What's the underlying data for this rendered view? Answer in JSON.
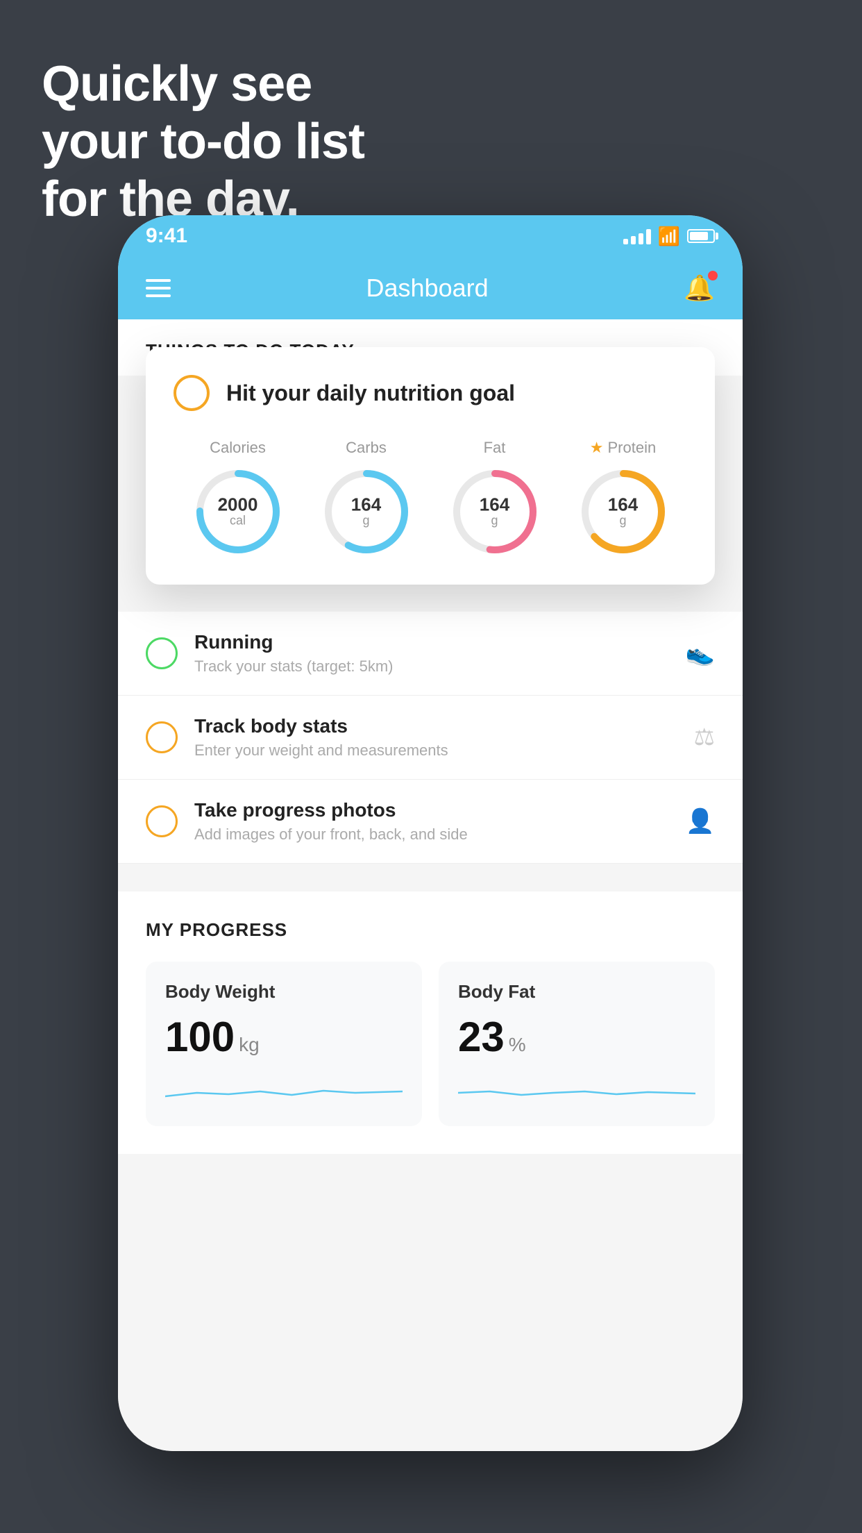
{
  "hero": {
    "line1": "Quickly see",
    "line2": "your to-do list",
    "line3": "for the day."
  },
  "status_bar": {
    "time": "9:41"
  },
  "nav": {
    "title": "Dashboard"
  },
  "section": {
    "things_title": "THINGS TO DO TODAY"
  },
  "floating_card": {
    "title": "Hit your daily nutrition goal",
    "nutrition": [
      {
        "label": "Calories",
        "value": "2000",
        "unit": "cal",
        "color": "blue",
        "star": false
      },
      {
        "label": "Carbs",
        "value": "164",
        "unit": "g",
        "color": "blue",
        "star": false
      },
      {
        "label": "Fat",
        "value": "164",
        "unit": "g",
        "color": "pink",
        "star": false
      },
      {
        "label": "Protein",
        "value": "164",
        "unit": "g",
        "color": "gold",
        "star": true
      }
    ]
  },
  "todo_items": [
    {
      "title": "Running",
      "subtitle": "Track your stats (target: 5km)",
      "circle": "green",
      "icon": "shoe"
    },
    {
      "title": "Track body stats",
      "subtitle": "Enter your weight and measurements",
      "circle": "yellow",
      "icon": "scale"
    },
    {
      "title": "Take progress photos",
      "subtitle": "Add images of your front, back, and side",
      "circle": "yellow",
      "icon": "person"
    }
  ],
  "progress": {
    "section_title": "MY PROGRESS",
    "cards": [
      {
        "title": "Body Weight",
        "value": "100",
        "unit": "kg"
      },
      {
        "title": "Body Fat",
        "value": "23",
        "unit": "%"
      }
    ]
  }
}
